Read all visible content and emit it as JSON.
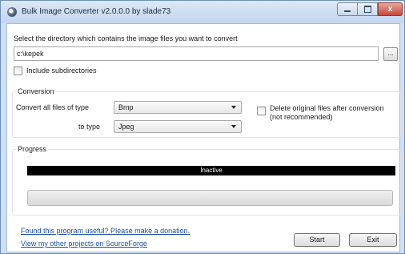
{
  "window": {
    "title": "Bulk Image Converter v2.0.0.0 by slade73",
    "minimize_label": "",
    "close_label": "x"
  },
  "directory": {
    "label": "Select the directory which contains the image files you want to convert",
    "value": "c:\\kepek",
    "browse_label": "...",
    "include_subdirectories": {
      "label": "Include subdirectories",
      "checked": false
    }
  },
  "conversion": {
    "group_title": "Conversion",
    "from_label": "Convert all files of type",
    "from_value": "Bmp",
    "to_label": "to type",
    "to_value": "Jpeg",
    "delete_original": {
      "label_line1": "Delete original files after conversion",
      "label_line2": "(not recommended)",
      "checked": false
    }
  },
  "progress": {
    "group_title": "Progress",
    "status": "Inactive",
    "percent": 0
  },
  "links": {
    "donate": "Found this program useful?  Please make a donation.",
    "projects": "View my other projects on SourceForge"
  },
  "buttons": {
    "start": "Start",
    "exit": "Exit"
  }
}
